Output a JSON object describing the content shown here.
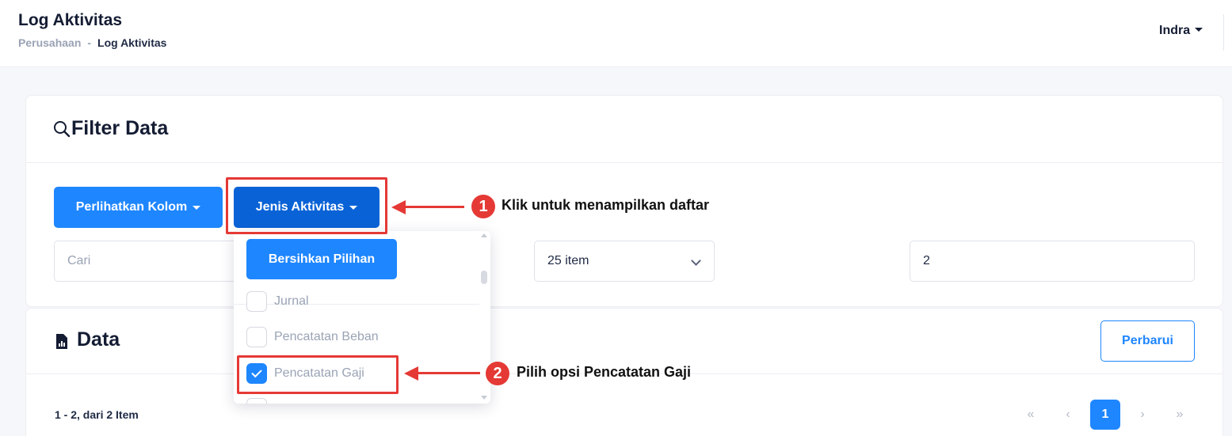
{
  "header": {
    "title": "Log Aktivitas",
    "breadcrumb_parent": "Perusahaan",
    "breadcrumb_separator": "-",
    "breadcrumb_current": "Log Aktivitas",
    "user_name": "Indra"
  },
  "filter": {
    "title": "Filter Data",
    "show_columns_label": "Perlihatkan Kolom",
    "activity_type_label": "Jenis Aktivitas",
    "search_placeholder": "Cari",
    "per_page_value": "25 item",
    "page_value": "2"
  },
  "dropdown": {
    "clear_label": "Bersihkan Pilihan",
    "options": [
      {
        "label": "Jurnal",
        "checked": false
      },
      {
        "label": "Pencatatan Beban",
        "checked": false
      },
      {
        "label": "Pencatatan Gaji",
        "checked": true
      }
    ]
  },
  "annotations": {
    "step1_number": "1",
    "step1_text": "Klik untuk menampilkan daftar",
    "step2_number": "2",
    "step2_text": "Pilih opsi Pencatatan Gaji",
    "color": "#e53935"
  },
  "data_section": {
    "title": "Data",
    "refresh_label": "Perbarui",
    "count_text": "1 - 2, dari 2 Item",
    "pager": {
      "first": "«",
      "prev": "‹",
      "current": "1",
      "next": "›",
      "last": "»"
    }
  },
  "colors": {
    "primary": "#1e86ff",
    "primary_dark": "#0a63d6",
    "annotation_red": "#e53935"
  }
}
